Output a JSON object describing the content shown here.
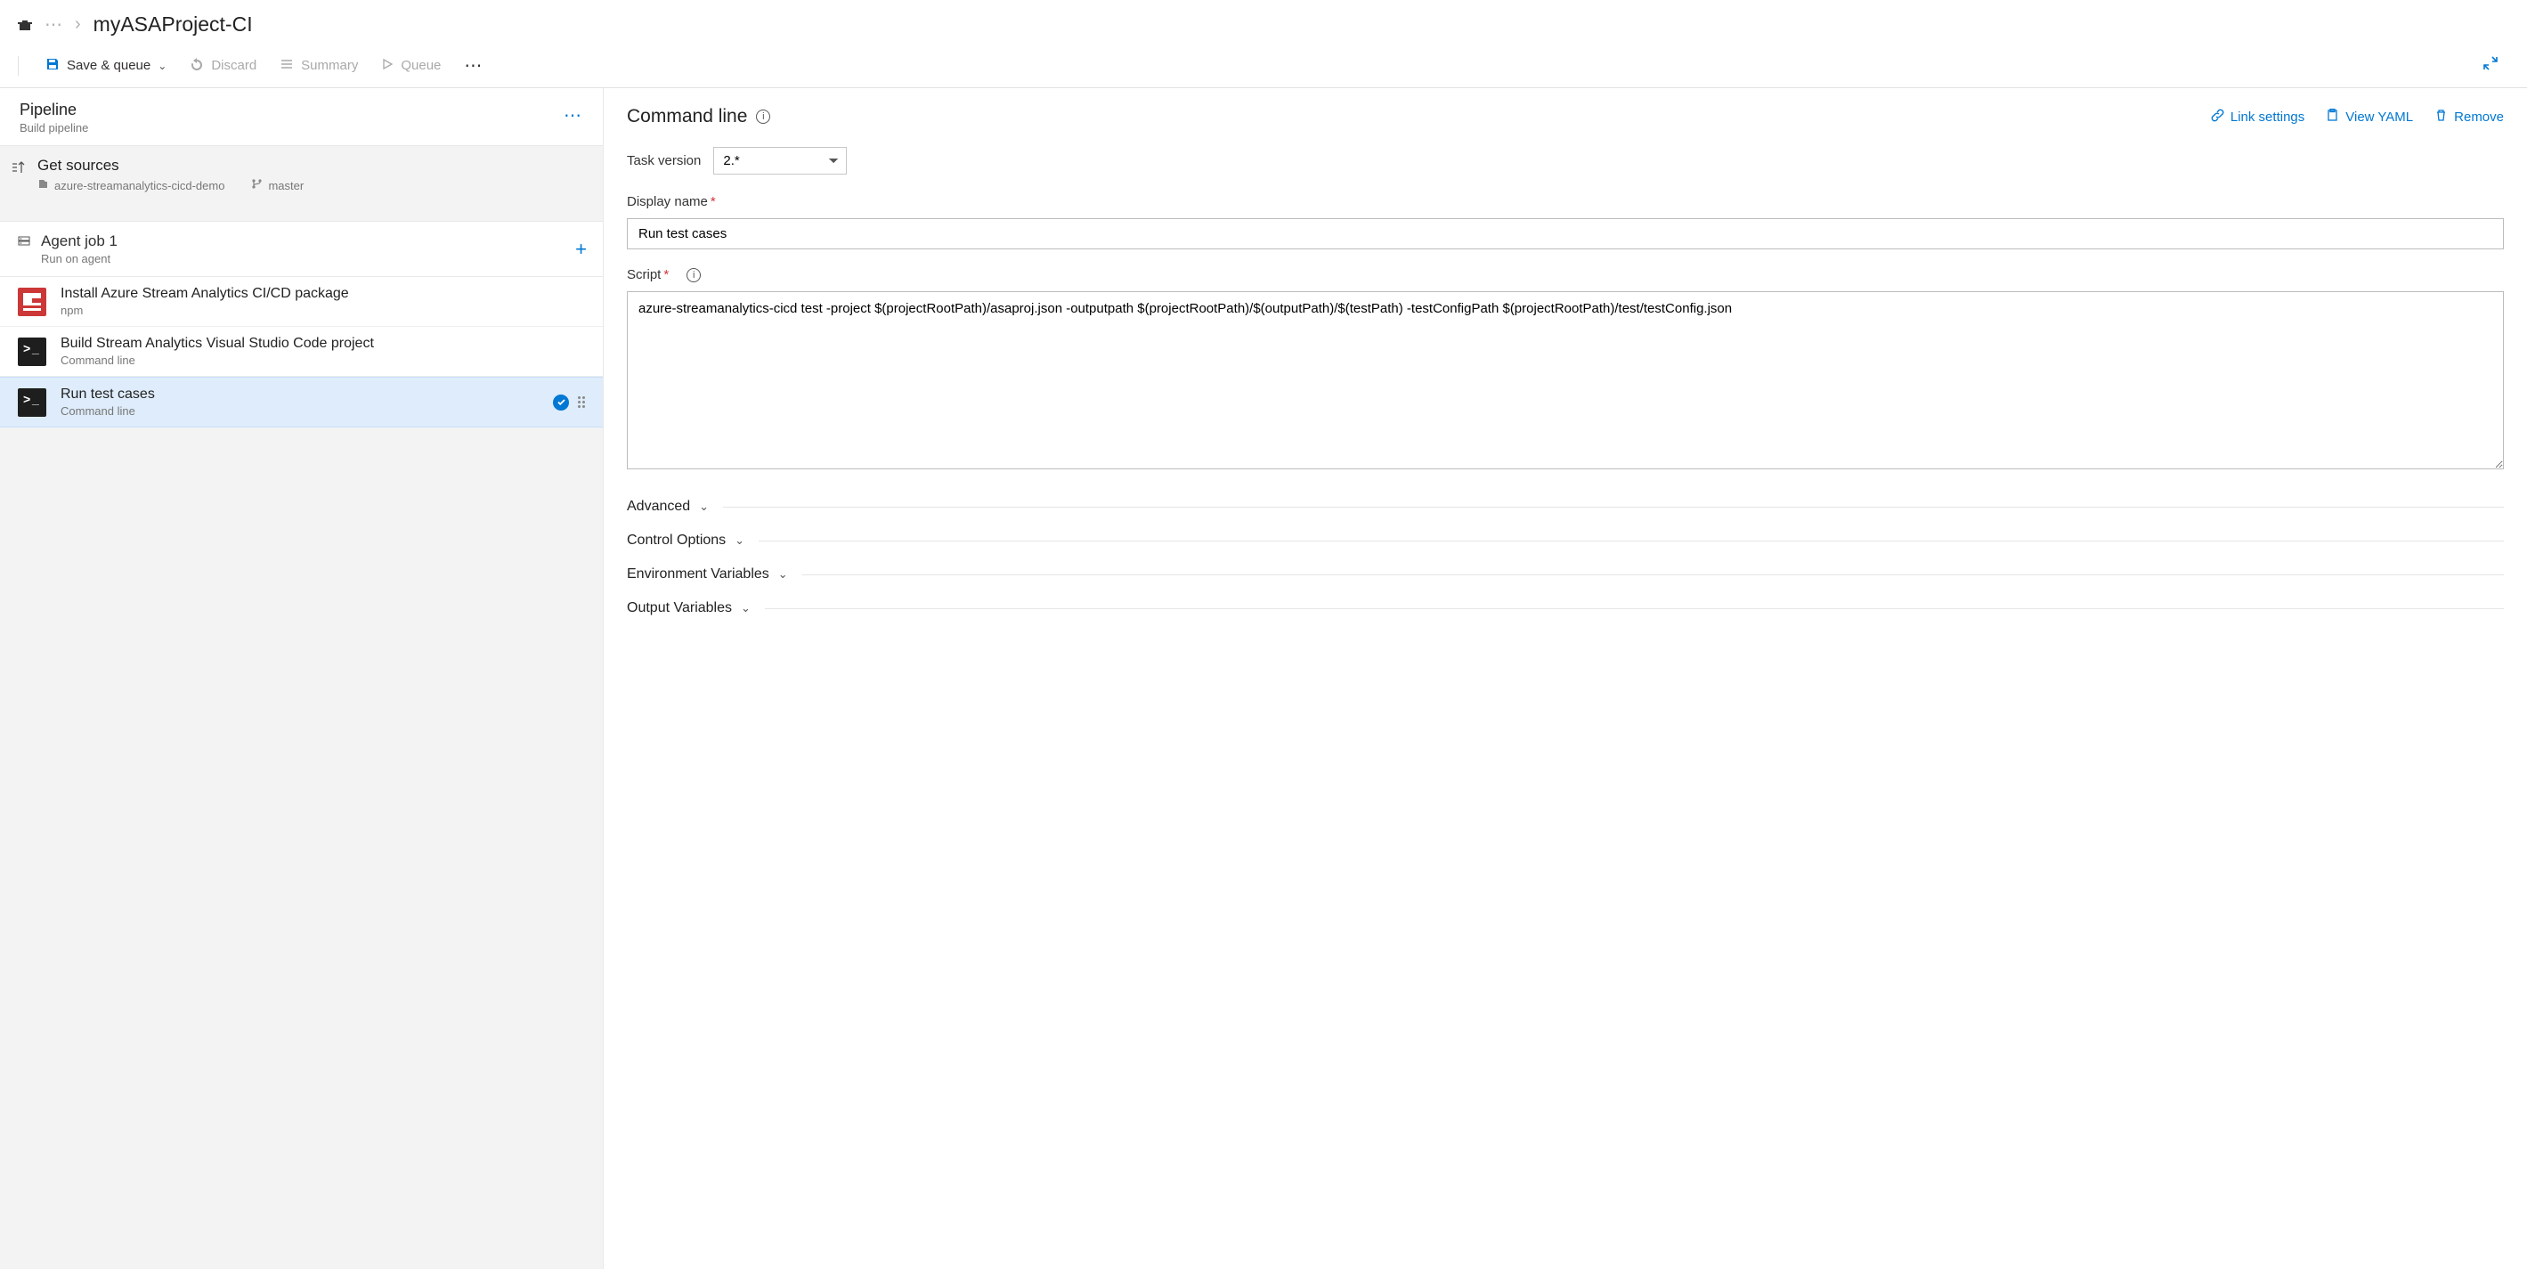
{
  "breadcrumb": {
    "project_ellipsis": "⋯",
    "title": "myASAProject-CI"
  },
  "toolbar": {
    "save_queue": "Save & queue",
    "discard": "Discard",
    "summary": "Summary",
    "queue": "Queue"
  },
  "pipeline": {
    "title": "Pipeline",
    "subtitle": "Build pipeline"
  },
  "sources": {
    "title": "Get sources",
    "repo": "azure-streamanalytics-cicd-demo",
    "branch": "master"
  },
  "agentJob": {
    "title": "Agent job 1",
    "subtitle": "Run on agent"
  },
  "tasks": [
    {
      "title": "Install Azure Stream Analytics CI/CD package",
      "subtitle": "npm",
      "icon": "npm"
    },
    {
      "title": "Build Stream Analytics Visual Studio Code project",
      "subtitle": "Command line",
      "icon": "cmd"
    },
    {
      "title": "Run test cases",
      "subtitle": "Command line",
      "icon": "cmd"
    }
  ],
  "detail": {
    "heading": "Command line",
    "link_settings": "Link settings",
    "view_yaml": "View YAML",
    "remove": "Remove",
    "task_version_label": "Task version",
    "task_version_value": "2.*",
    "display_name_label": "Display name",
    "display_name_value": "Run test cases",
    "script_label": "Script",
    "script_value": "azure-streamanalytics-cicd test -project $(projectRootPath)/asaproj.json -outputpath $(projectRootPath)/$(outputPath)/$(testPath) -testConfigPath $(projectRootPath)/test/testConfig.json",
    "sections": {
      "advanced": "Advanced",
      "control": "Control Options",
      "env": "Environment Variables",
      "output": "Output Variables"
    }
  }
}
